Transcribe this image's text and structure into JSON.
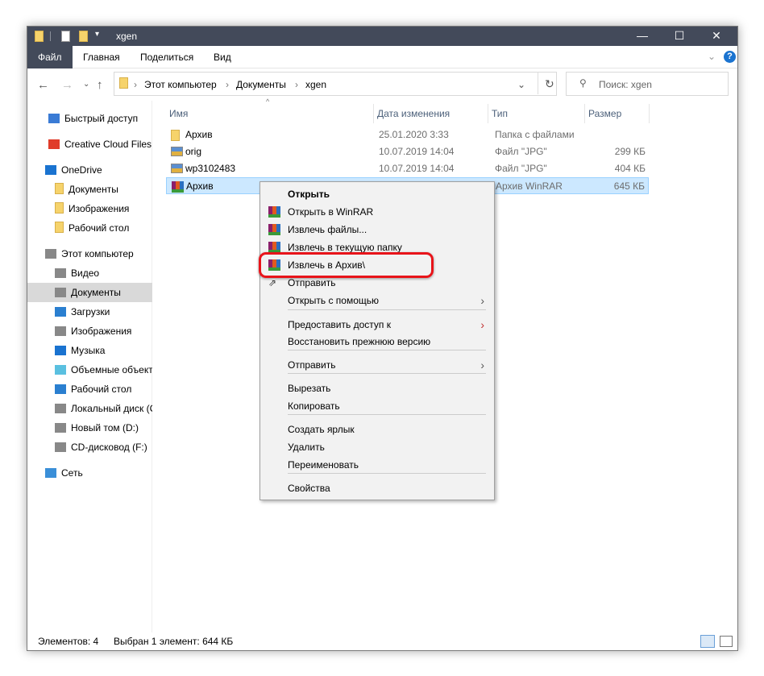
{
  "window": {
    "title": "xgen",
    "minimize": "—",
    "maximize": "☐",
    "close": "✕"
  },
  "ribbon": {
    "tabs": [
      "Файл",
      "Главная",
      "Поделиться",
      "Вид"
    ],
    "help": "?"
  },
  "address": {
    "crumbs": [
      "Этот компьютер",
      "Документы",
      "xgen"
    ],
    "search_placeholder": "Поиск: xgen"
  },
  "sidebar": [
    {
      "label": "Быстрый доступ",
      "icon": "star-icon"
    },
    {
      "label": "Creative Cloud Files",
      "icon": "creative-cloud-icon"
    },
    {
      "label": "OneDrive",
      "icon": "cloud-icon"
    },
    {
      "label": "Документы",
      "icon": "folder-icon"
    },
    {
      "label": "Изображения",
      "icon": "folder-icon"
    },
    {
      "label": "Рабочий стол",
      "icon": "folder-icon"
    },
    {
      "label": "Этот компьютер",
      "icon": "computer-icon"
    },
    {
      "label": "Видео",
      "icon": "video-icon"
    },
    {
      "label": "Документы",
      "icon": "documents-icon"
    },
    {
      "label": "Загрузки",
      "icon": "download-icon"
    },
    {
      "label": "Изображения",
      "icon": "pictures-icon"
    },
    {
      "label": "Музыка",
      "icon": "music-icon"
    },
    {
      "label": "Объемные объект",
      "icon": "3d-objects-icon"
    },
    {
      "label": "Рабочий стол",
      "icon": "desktop-icon"
    },
    {
      "label": "Локальный диск (C",
      "icon": "drive-icon"
    },
    {
      "label": "Новый том (D:)",
      "icon": "drive-icon"
    },
    {
      "label": "CD-дисковод (F:)",
      "icon": "cd-drive-icon"
    },
    {
      "label": "Сеть",
      "icon": "network-icon"
    }
  ],
  "columns": [
    "Имя",
    "Дата изменения",
    "Тип",
    "Размер"
  ],
  "files": [
    {
      "name": "Архив",
      "date": "25.01.2020 3:33",
      "type": "Папка с файлами",
      "size": "",
      "icon": "folder-icon"
    },
    {
      "name": "orig",
      "date": "10.07.2019 14:04",
      "type": "Файл \"JPG\"",
      "size": "299 КБ",
      "icon": "image-icon"
    },
    {
      "name": "wp3102483",
      "date": "10.07.2019 14:04",
      "type": "Файл \"JPG\"",
      "size": "404 КБ",
      "icon": "image-icon"
    },
    {
      "name": "Архив",
      "date": "",
      "type": "Архив WinRAR",
      "size": "645 КБ",
      "icon": "winrar-icon"
    }
  ],
  "context_menu": [
    "Открыть",
    "Открыть в WinRAR",
    "Извлечь файлы...",
    "Извлечь в текущую папку",
    "Извлечь в Архив\\",
    "Отправить",
    "Открыть с помощью",
    "Предоставить доступ к",
    "Восстановить прежнюю версию",
    "Отправить",
    "Вырезать",
    "Копировать",
    "Создать ярлык",
    "Удалить",
    "Переименовать",
    "Свойства"
  ],
  "status": {
    "count": "Элементов: 4",
    "selected": "Выбран 1 элемент: 644 КБ"
  },
  "colors": {
    "titlebar": "#434a5a",
    "selection": "#cce8ff",
    "highlight": "#e8141a"
  }
}
